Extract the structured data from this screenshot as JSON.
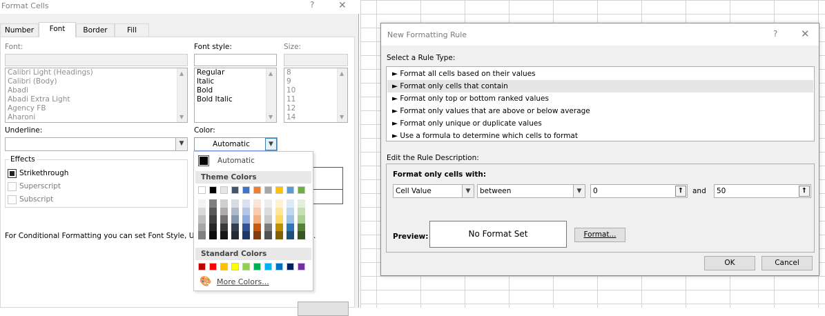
{
  "format_cells": {
    "title": "Format Cells",
    "help": "?",
    "close": "✕",
    "tabs": [
      "Number",
      "Font",
      "Border",
      "Fill"
    ],
    "active_tab": "Font",
    "font_label": "Font:",
    "font_list": [
      "Calibri Light (Headings)",
      "Calibri (Body)",
      "Abadi",
      "Abadi Extra Light",
      "Agency FB",
      "Aharoni"
    ],
    "font_style_label": "Font style:",
    "font_style_list": [
      "Regular",
      "Italic",
      "Bold",
      "Bold Italic"
    ],
    "size_label": "Size:",
    "size_list": [
      "8",
      "9",
      "10",
      "11",
      "12",
      "14"
    ],
    "underline_label": "Underline:",
    "color_label": "Color:",
    "color_value": "Automatic",
    "effects_label": "Effects",
    "strikethrough": "Strikethrough",
    "superscript": "Superscript",
    "subscript": "Subscript",
    "info_text": "For Conditional Formatting you can set Font Style, Ur",
    "info_tail": "."
  },
  "color_picker": {
    "automatic": "Automatic",
    "theme_colors_label": "Theme Colors",
    "theme_colors": [
      "#ffffff",
      "#000000",
      "#e7e6e6",
      "#44546a",
      "#4472c4",
      "#ed7d31",
      "#a5a5a5",
      "#ffc000",
      "#5b9bd5",
      "#70ad47"
    ],
    "theme_shades": [
      [
        "#f2f2f2",
        "#d9d9d9",
        "#bfbfbf",
        "#a6a6a6",
        "#808080"
      ],
      [
        "#7f7f7f",
        "#595959",
        "#404040",
        "#262626",
        "#0d0d0d"
      ],
      [
        "#d0cece",
        "#aeaaaa",
        "#757171",
        "#3a3838",
        "#171616"
      ],
      [
        "#d6dce4",
        "#adb9ca",
        "#8497b0",
        "#333f4f",
        "#222a35"
      ],
      [
        "#d9e1f2",
        "#b4c6e7",
        "#8ea9db",
        "#305496",
        "#203764"
      ],
      [
        "#fce4d6",
        "#f8cbad",
        "#f4b084",
        "#c65911",
        "#833c0c"
      ],
      [
        "#ededed",
        "#dbdbdb",
        "#c9c9c9",
        "#7b7b7b",
        "#525252"
      ],
      [
        "#fff2cc",
        "#ffe699",
        "#ffd966",
        "#bf8f00",
        "#806000"
      ],
      [
        "#ddebf7",
        "#bdd7ee",
        "#9bc2e6",
        "#2f75b5",
        "#1f4e78"
      ],
      [
        "#e2efda",
        "#c6e0b4",
        "#a9d08e",
        "#548235",
        "#375623"
      ]
    ],
    "standard_colors_label": "Standard Colors",
    "standard_colors": [
      "#c00000",
      "#ff0000",
      "#ffc000",
      "#ffff00",
      "#92d050",
      "#00b050",
      "#00b0f0",
      "#0070c0",
      "#002060",
      "#7030a0"
    ],
    "more_colors": "More Colors..."
  },
  "new_rule": {
    "title": "New Formatting Rule",
    "help": "?",
    "close": "✕",
    "select_type_label": "Select a Rule Type:",
    "rule_types": [
      "► Format all cells based on their values",
      "► Format only cells that contain",
      "► Format only top or bottom ranked values",
      "► Format only values that are above or below average",
      "► Format only unique or duplicate values",
      "► Use a formula to determine which cells to format"
    ],
    "selected_index": 1,
    "edit_label": "Edit the Rule Description:",
    "format_only_label": "Format only cells with:",
    "condition_type": "Cell Value",
    "operator": "between",
    "value1": "0",
    "and_label": "and",
    "value2": "50",
    "preview_label": "Preview:",
    "preview_text": "No Format Set",
    "format_button": "Format...",
    "ok": "OK",
    "cancel": "Cancel"
  }
}
